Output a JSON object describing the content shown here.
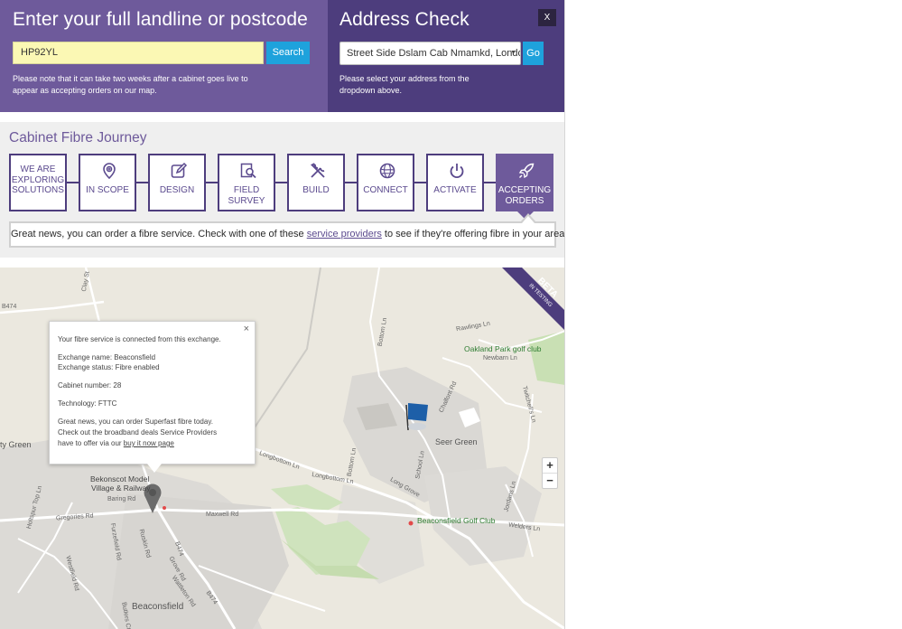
{
  "header_left": {
    "title": "Enter your full landline or postcode",
    "postcode_value": "HP92YL",
    "search_label": "Search",
    "note_line1": "Please note that it can take two weeks after a cabinet goes live to",
    "note_line2": "appear as accepting orders on our map."
  },
  "header_right": {
    "title": "Address Check",
    "close_label": "X",
    "address_selected": "Street Side Dslam Cab Nmamkd, London",
    "go_label": "Go",
    "note_line1": "Please select your address from the",
    "note_line2": "dropdown above."
  },
  "journey": {
    "title": "Cabinet Fibre Journey",
    "steps": [
      {
        "line1": "We are",
        "line2": "exploring",
        "line3": "solutions",
        "icon": "none"
      },
      {
        "line1": "In scope",
        "icon": "map-pin-icon"
      },
      {
        "line1": "Design",
        "icon": "pencil-square-icon"
      },
      {
        "line1": "Field",
        "line2": "survey",
        "icon": "document-search-icon"
      },
      {
        "line1": "Build",
        "icon": "tools-icon"
      },
      {
        "line1": "Connect",
        "icon": "globe-icon"
      },
      {
        "line1": "Activate",
        "icon": "power-icon"
      },
      {
        "line1": "Accepting",
        "line2": "orders",
        "icon": "rocket-icon"
      }
    ],
    "message_before": "Great news, you can order a fibre service. Check with one of these ",
    "message_link": "service providers",
    "message_after": " to see if they're offering fibre in your area."
  },
  "map": {
    "beta_label": "BETA",
    "beta_sub": "IN TESTING",
    "popup": {
      "line_connected": "Your fibre service is connected from this exchange.",
      "exchange_name": "Exchange name: Beaconsfield",
      "exchange_status": "Exchange status: Fibre enabled",
      "cabinet_number": "Cabinet number: 28",
      "technology": "Technology: FTTC",
      "order_line1": "Great news, you can order Superfast fibre today.",
      "order_line2": "Check out the broadband deals Service Providers",
      "order_line3_before": "have to offer via our ",
      "order_link": "buy it now page",
      "close": "×"
    },
    "labels": {
      "b474": "B474",
      "clay_st": "Clay St",
      "rawlings": "Rawlings Ln",
      "bottom_ln": "Bottom Ln",
      "oakland": "Oakland Park golf club",
      "newbarn": "Newbarn Ln",
      "twitchells": "Twitchell's Ln",
      "chalfont": "Chalfont Rd",
      "ty_green": "ty Green",
      "seer_green": "Seer Green",
      "longbottom1": "Longbottom Ln",
      "longbottom2": "Longbottom Ln",
      "long_grove": "Long Grove",
      "school_ln": "School Ln",
      "bottom_ln2": "Bottom Ln",
      "bekonscot1": "Bekonscot Model",
      "bekonscot2": "Village & Railway",
      "baring": "Baring Rd",
      "holtspur": "Holtspur Top Ln",
      "gregories": "Gregories Rd",
      "maxwell": "Maxwell Rd",
      "furzefield": "Furzefield Rd",
      "ruskin": "Ruskin Rd",
      "b474b": "B474",
      "grove": "Grove Rd",
      "westfield": "Westfield Rd",
      "wattleton": "Wattleton Rd",
      "butlers": "Butlers Ct",
      "beaconsfield": "Beaconsfield",
      "golf_club": "Beaconsfield Golf Club",
      "jordans": "Jordans Ln",
      "welders": "Welders Ln",
      "b474c": "B474"
    },
    "zoom_in": "+",
    "zoom_out": "−"
  },
  "colors": {
    "purple": "#6e5a9b",
    "dark_purple": "#4d3d7d",
    "blue_button": "#1ea2dc",
    "input_yellow": "#fbf8b4"
  }
}
